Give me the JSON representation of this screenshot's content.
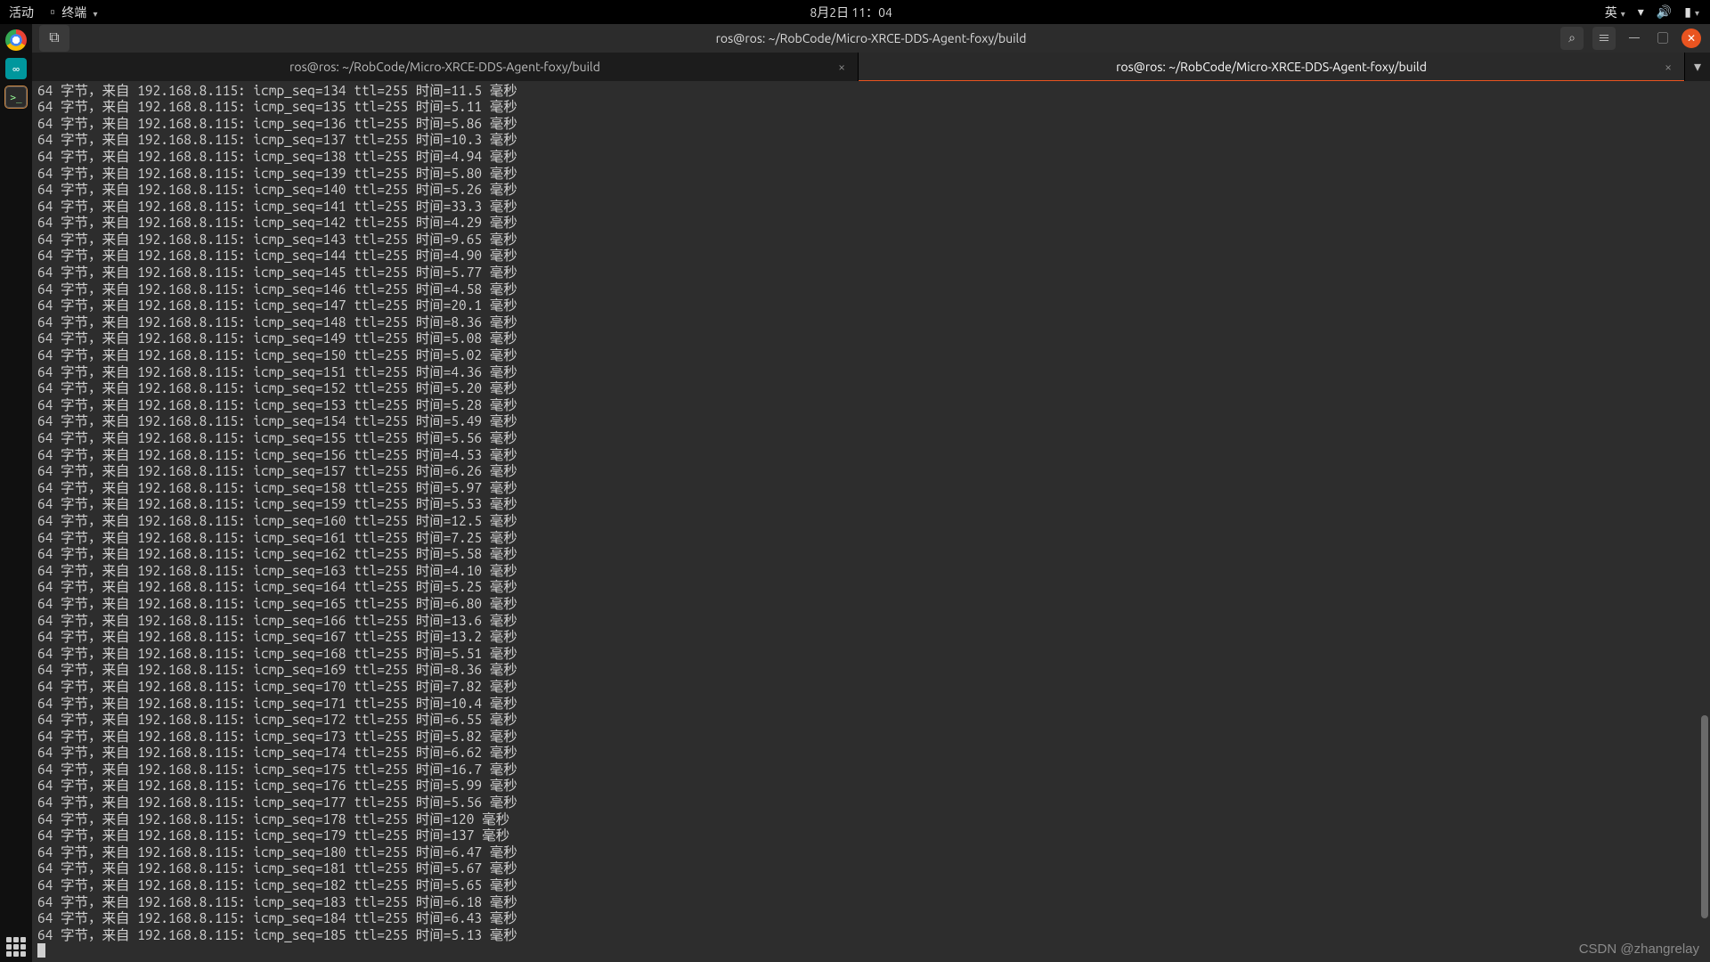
{
  "topbar": {
    "activities": "活动",
    "app": "终端",
    "clock": "8月2日 11：04",
    "ime": "英"
  },
  "dock": {
    "chrome": "chrome",
    "arduino_glyph": "∞",
    "term_glyph": ">_"
  },
  "window": {
    "title": "ros@ros: ~/RobCode/Micro-XRCE-DDS-Agent-foxy/build",
    "newtab_glyph": "⧉",
    "search_glyph": "⌕",
    "menu_glyph": "≡",
    "min_glyph": "—",
    "max_glyph": "▢",
    "close_glyph": "✕"
  },
  "tabs": [
    {
      "label": "ros@ros: ~/RobCode/Micro-XRCE-DDS-Agent-foxy/build",
      "active": false
    },
    {
      "label": "ros@ros: ~/RobCode/Micro-XRCE-DDS-Agent-foxy/build",
      "active": true
    }
  ],
  "tab_close_glyph": "×",
  "tab_menu_glyph": "▾",
  "ping": {
    "host": "192.168.8.115",
    "bytes": "64",
    "prefix": "字节，来自",
    "ttl": "255",
    "time_label": "时间",
    "unit": "毫秒",
    "rows": [
      {
        "seq": "134",
        "t": "11.5"
      },
      {
        "seq": "135",
        "t": "5.11"
      },
      {
        "seq": "136",
        "t": "5.86"
      },
      {
        "seq": "137",
        "t": "10.3"
      },
      {
        "seq": "138",
        "t": "4.94"
      },
      {
        "seq": "139",
        "t": "5.80"
      },
      {
        "seq": "140",
        "t": "5.26"
      },
      {
        "seq": "141",
        "t": "33.3"
      },
      {
        "seq": "142",
        "t": "4.29"
      },
      {
        "seq": "143",
        "t": "9.65"
      },
      {
        "seq": "144",
        "t": "4.90"
      },
      {
        "seq": "145",
        "t": "5.77"
      },
      {
        "seq": "146",
        "t": "4.58"
      },
      {
        "seq": "147",
        "t": "20.1"
      },
      {
        "seq": "148",
        "t": "8.36"
      },
      {
        "seq": "149",
        "t": "5.08"
      },
      {
        "seq": "150",
        "t": "5.02"
      },
      {
        "seq": "151",
        "t": "4.36"
      },
      {
        "seq": "152",
        "t": "5.20"
      },
      {
        "seq": "153",
        "t": "5.28"
      },
      {
        "seq": "154",
        "t": "5.49"
      },
      {
        "seq": "155",
        "t": "5.56"
      },
      {
        "seq": "156",
        "t": "4.53"
      },
      {
        "seq": "157",
        "t": "6.26"
      },
      {
        "seq": "158",
        "t": "5.97"
      },
      {
        "seq": "159",
        "t": "5.53"
      },
      {
        "seq": "160",
        "t": "12.5"
      },
      {
        "seq": "161",
        "t": "7.25"
      },
      {
        "seq": "162",
        "t": "5.58"
      },
      {
        "seq": "163",
        "t": "4.10"
      },
      {
        "seq": "164",
        "t": "5.25"
      },
      {
        "seq": "165",
        "t": "6.80"
      },
      {
        "seq": "166",
        "t": "13.6"
      },
      {
        "seq": "167",
        "t": "13.2"
      },
      {
        "seq": "168",
        "t": "5.51"
      },
      {
        "seq": "169",
        "t": "8.36"
      },
      {
        "seq": "170",
        "t": "7.82"
      },
      {
        "seq": "171",
        "t": "10.4"
      },
      {
        "seq": "172",
        "t": "6.55"
      },
      {
        "seq": "173",
        "t": "5.82"
      },
      {
        "seq": "174",
        "t": "6.62"
      },
      {
        "seq": "175",
        "t": "16.7"
      },
      {
        "seq": "176",
        "t": "5.99"
      },
      {
        "seq": "177",
        "t": "5.56"
      },
      {
        "seq": "178",
        "t": "120"
      },
      {
        "seq": "179",
        "t": "137"
      },
      {
        "seq": "180",
        "t": "6.47"
      },
      {
        "seq": "181",
        "t": "5.67"
      },
      {
        "seq": "182",
        "t": "5.65"
      },
      {
        "seq": "183",
        "t": "6.18"
      },
      {
        "seq": "184",
        "t": "6.43"
      },
      {
        "seq": "185",
        "t": "5.13"
      }
    ]
  },
  "scrollbar": {
    "top_pct": 72,
    "height_pct": 23
  },
  "watermark": "CSDN @zhangrelay"
}
